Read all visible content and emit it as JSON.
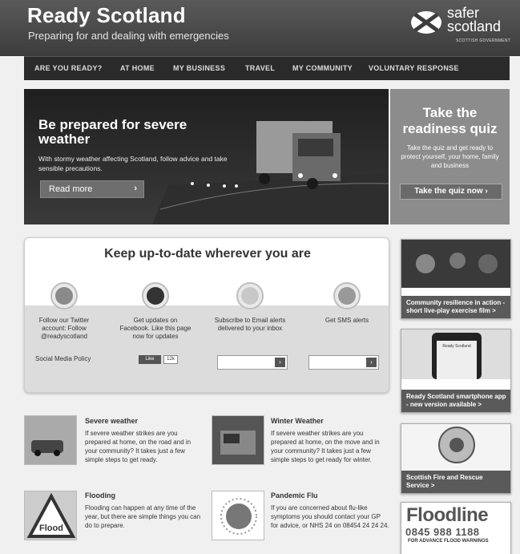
{
  "header": {
    "title": "Ready Scotland",
    "tagline": "Preparing for and dealing with emergencies",
    "logo_text_line1": "safer",
    "logo_text_line2": "scotland",
    "logo_sub": "SCOTTISH GOVERNMENT"
  },
  "nav": {
    "items": [
      {
        "label": "ARE YOU READY?"
      },
      {
        "label": "AT HOME"
      },
      {
        "label": "MY BUSINESS"
      },
      {
        "label": "TRAVEL"
      },
      {
        "label": "MY COMMUNITY"
      },
      {
        "label": "VOLUNTARY RESPONSE"
      }
    ]
  },
  "banner": {
    "title": "Be prepared for severe weather",
    "text": "With stormy weather affecting Scotland, follow advice and take sensible precautions.",
    "button_label": "Read more"
  },
  "quiz": {
    "title": "Take the readiness quiz",
    "text": "Take the quiz and get ready to protect yourself, your home, family and business",
    "button_label": "Take the quiz now"
  },
  "social": {
    "heading": "Keep up-to-date wherever you are",
    "twitter_text": "Follow our Twitter account: Follow @readyscotland",
    "facebook_text": "Get updates on Facebook. Like this page now for updates",
    "email_text": "Subscribe to Email alerts delivered to your inbox",
    "sms_text": "Get SMS alerts",
    "policy_label": "Social Media Policy",
    "fb_like_label": "Like",
    "fb_like_count": "12k"
  },
  "articles": [
    {
      "title": "Severe weather",
      "text": "If severe weather strikes are you prepared at home, on the road and in your community? It takes just a few simple steps to get ready."
    },
    {
      "title": "Winter Weather",
      "text": "If severe weather strikes are you prepared at home, on the move and in your community? It takes just a few simple steps to get ready for winter."
    },
    {
      "title": "Flooding",
      "text": "Flooding can happen at any time of the year, but there are simple things you can do to prepare."
    },
    {
      "title": "Pandemic Flu",
      "text": "If you are concerned about flu-like symptoms you should contact your GP for advice, or NHS 24 on 08454 24 24 24."
    }
  ],
  "sidebar": {
    "cards": [
      {
        "caption": "Community resilience in action - short live-play exercise film >"
      },
      {
        "caption": "Ready Scotland smartphone app - new version available >"
      },
      {
        "caption": "Scottish Fire and Rescue Service >"
      }
    ],
    "phone_header": "Ready Scotland",
    "floodline_title": "Floodline",
    "floodline_number": "0845 988 1188",
    "floodline_sub": "FOR ADVANCE FLOOD WARNINGS"
  },
  "article_flood_sign": "Flood",
  "colors": {
    "header_bg": "#3c3c3c",
    "nav_bg": "#2a2a2a",
    "quiz_bg": "#8c8c8c",
    "caption_bg": "#5a5a5a"
  },
  "icons": [
    "twitter-icon",
    "facebook-icon",
    "email-icon",
    "sms-icon",
    "saltire-icon",
    "chevron-right-icon"
  ]
}
